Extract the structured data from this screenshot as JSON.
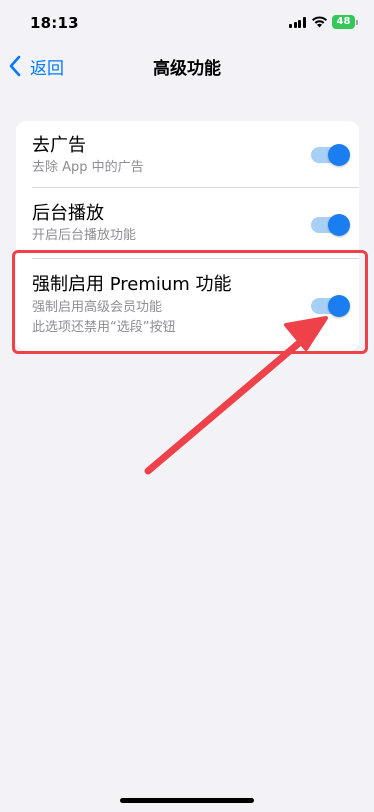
{
  "status_bar": {
    "time": "18:13",
    "battery": "48"
  },
  "nav": {
    "back_label": "返回",
    "title": "高级功能"
  },
  "settings": [
    {
      "title": "去广告",
      "subtitle": "去除 App 中的广告",
      "enabled": true
    },
    {
      "title": "后台播放",
      "subtitle": "开启后台播放功能",
      "enabled": true
    },
    {
      "title": "强制启用 Premium 功能",
      "subtitle_lines": [
        "强制启用高级会员功能",
        "此选项还禁用“选段”按钮"
      ],
      "enabled": true
    }
  ],
  "colors": {
    "accent": "#007aff",
    "toggle_thumb": "#1a7ef0",
    "toggle_track": "#a8cff6",
    "annotation": "#ee4149",
    "battery": "#34c759"
  },
  "icons": [
    "chevron-left-icon",
    "signal-icon",
    "wifi-icon",
    "battery-icon"
  ]
}
